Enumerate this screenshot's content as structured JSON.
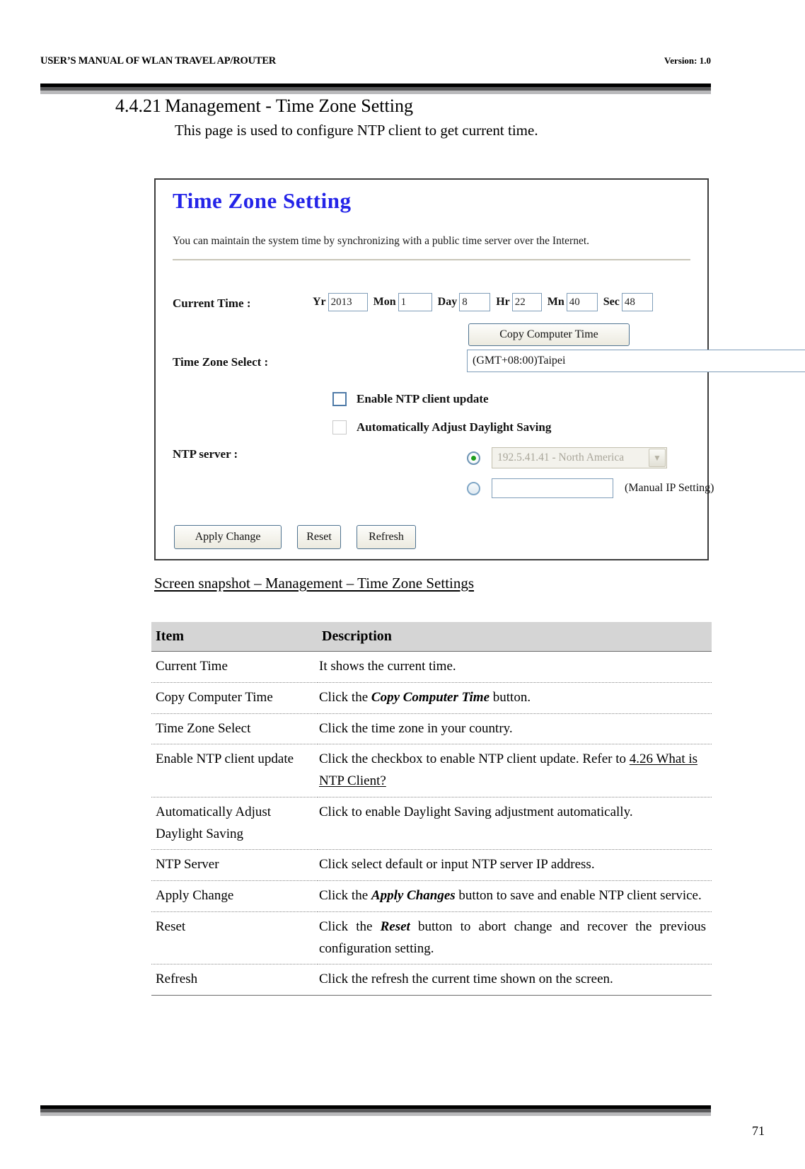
{
  "header": {
    "left": "USER’S MANUAL OF WLAN TRAVEL AP/ROUTER",
    "right": "Version: 1.0"
  },
  "section": {
    "number": "4.4.21",
    "title": "Management - Time Zone Setting",
    "intro": "This page is used to configure NTP client to get current time."
  },
  "screenshot": {
    "title": "Time Zone Setting",
    "description": "You can maintain the system time by synchronizing with a public time server over the Internet.",
    "current_time_label": "Current Time :",
    "time_fields": [
      {
        "label": "Yr",
        "value": "2013"
      },
      {
        "label": "Mon",
        "value": "1"
      },
      {
        "label": "Day",
        "value": "8"
      },
      {
        "label": "Hr",
        "value": "22"
      },
      {
        "label": "Mn",
        "value": "40"
      },
      {
        "label": "Sec",
        "value": "48"
      }
    ],
    "copy_button": "Copy Computer Time",
    "time_zone_label": "Time Zone Select :",
    "time_zone_value": "(GMT+08:00)Taipei",
    "checkbox_ntp": {
      "label": "Enable NTP client update",
      "checked": false
    },
    "checkbox_dst": {
      "label": "Automatically Adjust Daylight Saving",
      "checked": false
    },
    "ntp_server_label": "NTP server :",
    "ntp_server_value": "192.5.41.41 - North America",
    "manual_ip_value": "",
    "manual_ip_label": "(Manual IP Setting)",
    "buttons": {
      "apply": "Apply Change",
      "reset": "Reset",
      "refresh": "Refresh"
    },
    "colors": {
      "title": "#2424e8",
      "input_border": "#7f9db9",
      "radio_dot": "#1e9e1e",
      "disabled_text": "#a9a69a"
    }
  },
  "caption": "Screen snapshot – Management – Time Zone Settings",
  "table": {
    "headers": {
      "item": "Item",
      "description": "Description"
    },
    "rows": [
      {
        "item": "Current Time",
        "desc_pre": "It shows the current time.",
        "desc_em": "",
        "desc_post": "",
        "xref": ""
      },
      {
        "item": "Copy Computer Time",
        "desc_pre": "Click the ",
        "desc_em": "Copy Computer Time",
        "desc_post": " button.",
        "xref": ""
      },
      {
        "item": "Time Zone Select",
        "desc_pre": "Click the time zone in your country.",
        "desc_em": "",
        "desc_post": "",
        "xref": ""
      },
      {
        "item": "Enable NTP client update",
        "desc_pre": "Click the checkbox to enable NTP client update. Refer to ",
        "desc_em": "",
        "desc_post": "",
        "xref": "4.26 What is NTP Client?"
      },
      {
        "item": "Automatically Adjust Daylight Saving",
        "desc_pre": "Click to enable Daylight Saving adjustment automatically.",
        "desc_em": "",
        "desc_post": "",
        "xref": ""
      },
      {
        "item": "NTP Server",
        "desc_pre": "Click select default or input NTP server IP address.",
        "desc_em": "",
        "desc_post": "",
        "xref": ""
      },
      {
        "item": "Apply Change",
        "desc_pre": "Click the ",
        "desc_em": "Apply Changes",
        "desc_post": " button to save and enable NTP client service.",
        "xref": ""
      },
      {
        "item": "Reset",
        "desc_pre": "Click the ",
        "desc_em": "Reset",
        "desc_post": " button to abort change and recover the previous configuration setting.",
        "xref": ""
      },
      {
        "item": "Refresh",
        "desc_pre": "Click the refresh the current time shown on the screen.",
        "desc_em": "",
        "desc_post": "",
        "xref": ""
      }
    ]
  },
  "page_number": "71"
}
